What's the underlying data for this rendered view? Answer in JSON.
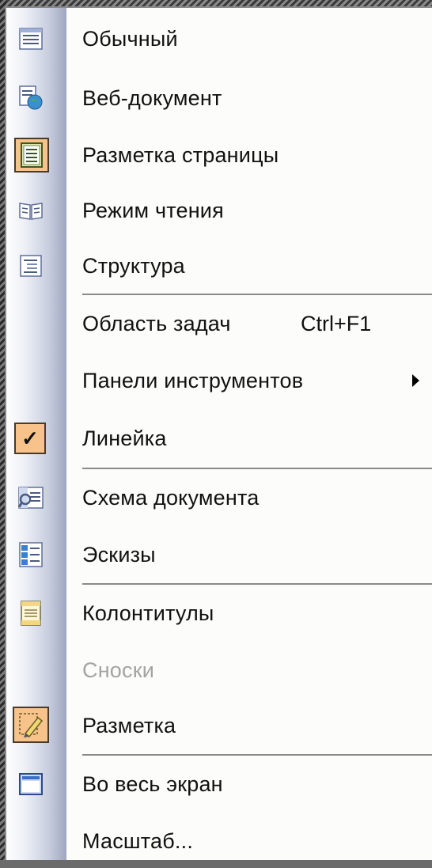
{
  "menu": {
    "items": [
      {
        "label": "Обычный",
        "icon": "normal-view-icon"
      },
      {
        "label": "Веб-документ",
        "icon": "web-document-icon"
      },
      {
        "label": "Разметка страницы",
        "icon": "page-layout-icon"
      },
      {
        "label": "Режим чтения",
        "icon": "reading-mode-icon"
      },
      {
        "label": "Структура",
        "icon": "outline-icon"
      },
      {
        "label": "Область задач",
        "shortcut": "Ctrl+F1"
      },
      {
        "label": "Панели инструментов"
      },
      {
        "label": "Линейка",
        "icon": "checkmark-icon",
        "checkmark": "✓"
      },
      {
        "label": "Схема документа",
        "icon": "document-map-icon"
      },
      {
        "label": "Эскизы",
        "icon": "thumbnails-icon"
      },
      {
        "label": "Колонтитулы",
        "icon": "header-footer-icon"
      },
      {
        "label": "Сноски",
        "disabled": true
      },
      {
        "label": "Разметка",
        "icon": "markup-icon"
      },
      {
        "label": "Во весь экран",
        "icon": "full-screen-icon"
      },
      {
        "label": "Масштаб..."
      }
    ]
  }
}
